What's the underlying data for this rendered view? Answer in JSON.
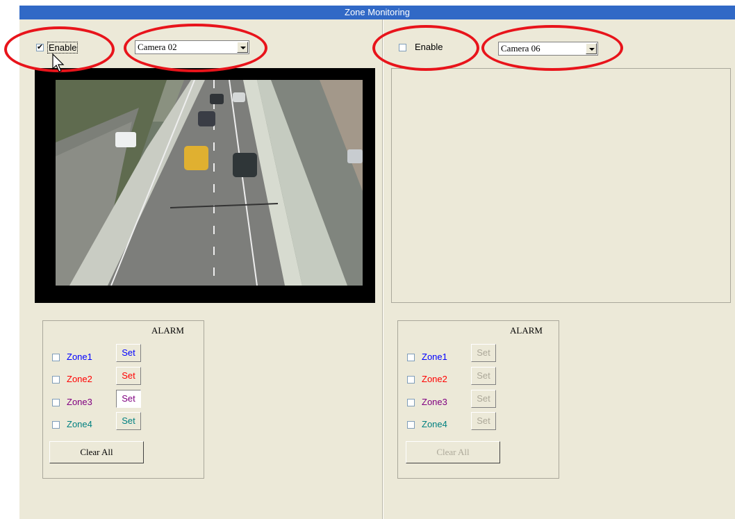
{
  "window": {
    "title": "Zone Monitoring"
  },
  "colors": {
    "ring": "#e8141b",
    "zone1": "#0000ff",
    "zone2": "#ff0000",
    "zone3": "#800080",
    "zone4": "#008080"
  },
  "left": {
    "enable_label": "Enable",
    "enable_checked": true,
    "camera": "Camera 02",
    "alarm": {
      "title": "ALARM",
      "zones": [
        {
          "label": "Zone1",
          "set": "Set"
        },
        {
          "label": "Zone2",
          "set": "Set"
        },
        {
          "label": "Zone3",
          "set": "Set"
        },
        {
          "label": "Zone4",
          "set": "Set"
        }
      ],
      "clear_all": "Clear All"
    }
  },
  "right": {
    "enable_label": "Enable",
    "enable_checked": false,
    "camera": "Camera 06",
    "alarm": {
      "title": "ALARM",
      "zones": [
        {
          "label": "Zone1",
          "set": "Set"
        },
        {
          "label": "Zone2",
          "set": "Set"
        },
        {
          "label": "Zone3",
          "set": "Set"
        },
        {
          "label": "Zone4",
          "set": "Set"
        }
      ],
      "clear_all": "Clear All"
    }
  }
}
